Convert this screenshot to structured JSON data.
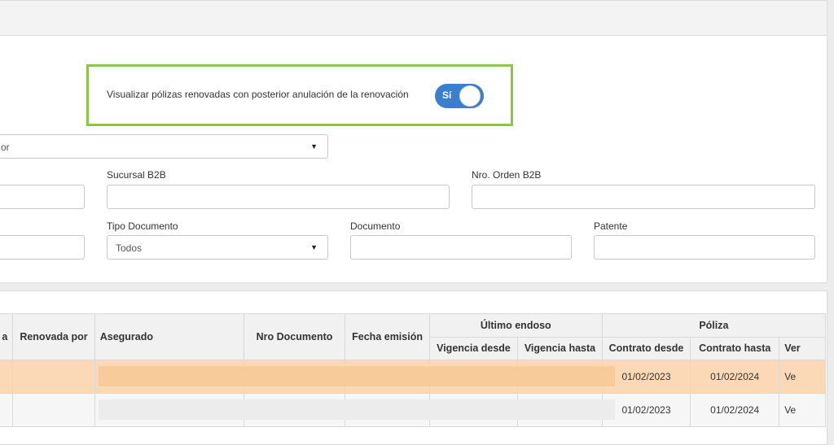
{
  "toggle": {
    "label": "Visualizar pólizas renovadas con posterior anulación de la renovación",
    "state": "Sí",
    "on": true,
    "color": "#3a7ed0"
  },
  "highlight_color": "#8cc63f",
  "filters": {
    "first_select_value": "or",
    "sucursal_label": "Sucursal B2B",
    "nro_orden_label": "Nro. Orden B2B",
    "tipo_doc_label": "Tipo Documento",
    "tipo_doc_value": "Todos",
    "documento_label": "Documento",
    "patente_label": "Patente"
  },
  "table": {
    "headers": {
      "col0": "a",
      "renovada_por": "Renovada por",
      "asegurado": "Asegurado",
      "nro_documento": "Nro Documento",
      "fecha_emision": "Fecha emisión",
      "ultimo_endoso": "Último endoso",
      "vigencia_desde": "Vigencia desde",
      "vigencia_hasta": "Vigencia hasta",
      "poliza": "Póliza",
      "contrato_desde": "Contrato desde",
      "contrato_hasta": "Contrato hasta",
      "ver": "Ver"
    },
    "rows": [
      {
        "contrato_desde": "01/02/2023",
        "contrato_hasta": "01/02/2024",
        "ver": "Ve",
        "highlighted": true
      },
      {
        "contrato_desde": "01/02/2023",
        "contrato_hasta": "01/02/2024",
        "ver": "Ve",
        "highlighted": false
      }
    ],
    "highlight_row_color": "#fcd9b6"
  }
}
